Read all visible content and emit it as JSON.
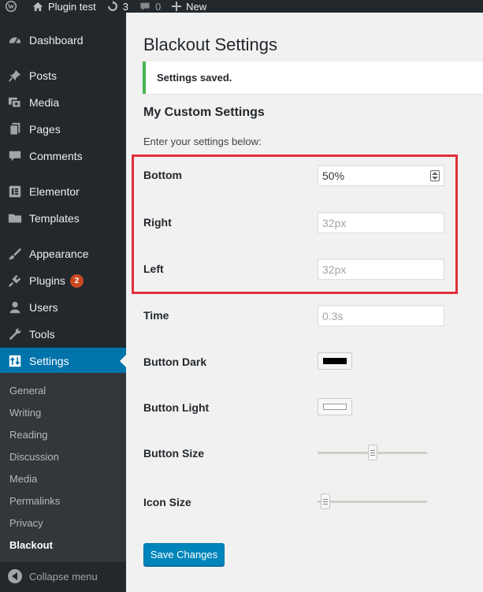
{
  "adminbar": {
    "site_name": "Plugin test",
    "updates_count": "3",
    "comments_count": "0",
    "new_label": "New"
  },
  "sidebar": {
    "items": [
      {
        "label": "Dashboard",
        "icon": "dashboard-icon"
      },
      {
        "label": "Posts",
        "icon": "pin-icon"
      },
      {
        "label": "Media",
        "icon": "media-icon"
      },
      {
        "label": "Pages",
        "icon": "pages-icon"
      },
      {
        "label": "Comments",
        "icon": "comment-icon"
      },
      {
        "label": "Elementor",
        "icon": "elementor-icon"
      },
      {
        "label": "Templates",
        "icon": "folder-icon"
      },
      {
        "label": "Appearance",
        "icon": "brush-icon"
      },
      {
        "label": "Plugins",
        "icon": "plugin-icon",
        "badge": "2"
      },
      {
        "label": "Users",
        "icon": "user-icon"
      },
      {
        "label": "Tools",
        "icon": "wrench-icon"
      },
      {
        "label": "Settings",
        "icon": "settings-icon",
        "active": true
      }
    ],
    "submenu": [
      "General",
      "Writing",
      "Reading",
      "Discussion",
      "Media",
      "Permalinks",
      "Privacy",
      "Blackout"
    ],
    "submenu_current": "Blackout",
    "collapse_label": "Collapse menu"
  },
  "main": {
    "title": "Blackout Settings",
    "notice": "Settings saved.",
    "section_title": "My Custom Settings",
    "section_desc": "Enter your settings below:",
    "fields": {
      "bottom": {
        "label": "Bottom",
        "value": "50%"
      },
      "right": {
        "label": "Right",
        "placeholder": "32px"
      },
      "left": {
        "label": "Left",
        "placeholder": "32px"
      },
      "time": {
        "label": "Time",
        "placeholder": "0.3s"
      },
      "button_dark": {
        "label": "Button Dark",
        "color": "#000000"
      },
      "button_light": {
        "label": "Button Light",
        "color": "#ffffff"
      },
      "button_size": {
        "label": "Button Size",
        "level": 0.5
      },
      "icon_size": {
        "label": "Icon Size",
        "level": 0.03
      }
    },
    "save_label": "Save Changes"
  },
  "colors": {
    "adminbar_bg": "#23282d",
    "sidebar_bg": "#23282d",
    "submenu_bg": "#32373c",
    "active_bg": "#0073aa",
    "notice_border": "#46b450",
    "highlight_border": "#e0303a",
    "primary_button": "#0085ba",
    "badge_bg": "#ca4a1f"
  }
}
